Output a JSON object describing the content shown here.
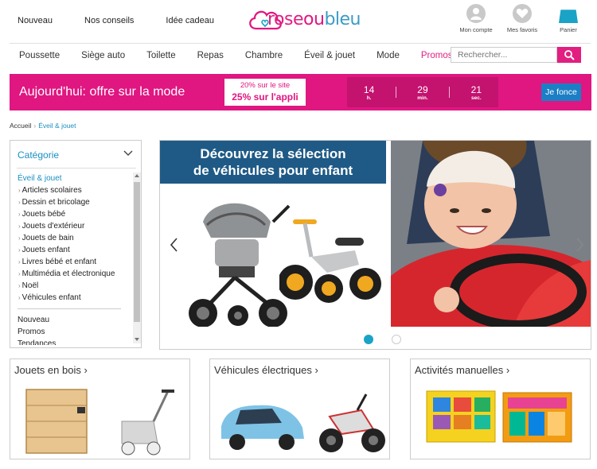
{
  "header": {
    "top_links": [
      "Nouveau",
      "Nos conseils",
      "Idée cadeau"
    ],
    "logo": {
      "part1": "rose",
      "part2": "ou",
      "part3": "bleu"
    },
    "user_actions": [
      {
        "label": "Mon compte",
        "icon": "user-icon"
      },
      {
        "label": "Mes favoris",
        "icon": "heart-icon"
      },
      {
        "label": "Panier",
        "icon": "bag-icon"
      }
    ]
  },
  "nav": {
    "items": [
      "Poussette",
      "Siège auto",
      "Toilette",
      "Repas",
      "Chambre",
      "Éveil & jouet",
      "Mode",
      "Promos %"
    ],
    "search_placeholder": "Rechercher..."
  },
  "banner": {
    "headline": "Aujourd'hui: offre sur la mode",
    "offer_line1": "20% sur le site",
    "offer_line2": "25% sur l'appli",
    "countdown": [
      {
        "value": "14",
        "unit": "h."
      },
      {
        "value": "29",
        "unit": "min."
      },
      {
        "value": "21",
        "unit": "sec."
      }
    ],
    "cta": "Je fonce"
  },
  "breadcrumb": {
    "home": "Accueil",
    "current": "Éveil & jouet"
  },
  "sidebar": {
    "heading": "Catégorie",
    "active_category": "Éveil & jouet",
    "subcategories": [
      "Articles scolaires",
      "Dessin et bricolage",
      "Jouets bébé",
      "Jouets d'extérieur",
      "Jouets de bain",
      "Jouets enfant",
      "Livres bébé et enfant",
      "Multimédia et électronique",
      "Noël",
      "Véhicules enfant"
    ],
    "extra": [
      "Nouveau",
      "Promos",
      "Tendances"
    ]
  },
  "carousel": {
    "title_line1": "Découvrez la sélection",
    "title_line2": "de véhicules pour enfant",
    "active_slide": 1,
    "slide_count": 2
  },
  "cards": [
    {
      "title": "Jouets en bois ›"
    },
    {
      "title": "Véhicules électriques ›"
    },
    {
      "title": "Activités manuelles ›"
    }
  ],
  "colors": {
    "brand_pink": "#e01681",
    "brand_blue": "#1aa3c6",
    "cta_blue": "#1b7fc5",
    "title_navy": "#1f5a86"
  }
}
